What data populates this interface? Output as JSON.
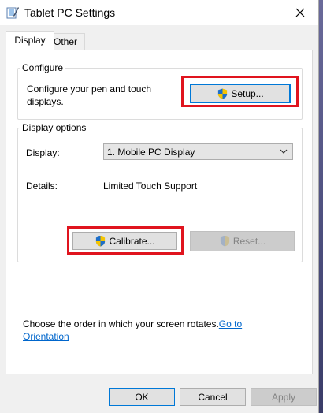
{
  "window": {
    "title": "Tablet PC Settings",
    "icon": "tablet-pen-icon",
    "close_icon": "close-icon"
  },
  "tabs": [
    {
      "label": "Display",
      "selected": true
    },
    {
      "label": "Other",
      "selected": false
    }
  ],
  "configure": {
    "group_title": "Configure",
    "description": "Configure your pen and touch displays.",
    "setup_button": "Setup..."
  },
  "display_options": {
    "group_title": "Display options",
    "display_label": "Display:",
    "display_value": "1. Mobile PC Display",
    "details_label": "Details:",
    "details_value": "Limited Touch Support",
    "calibrate_button": "Calibrate...",
    "reset_button": "Reset..."
  },
  "rotation": {
    "text": "Choose the order in which your screen rotates.",
    "link": "Go to Orientation"
  },
  "footer": {
    "ok": "OK",
    "cancel": "Cancel",
    "apply": "Apply"
  },
  "colors": {
    "highlight": "#e0141e",
    "link": "#0066cc",
    "accent": "#0078d7"
  }
}
